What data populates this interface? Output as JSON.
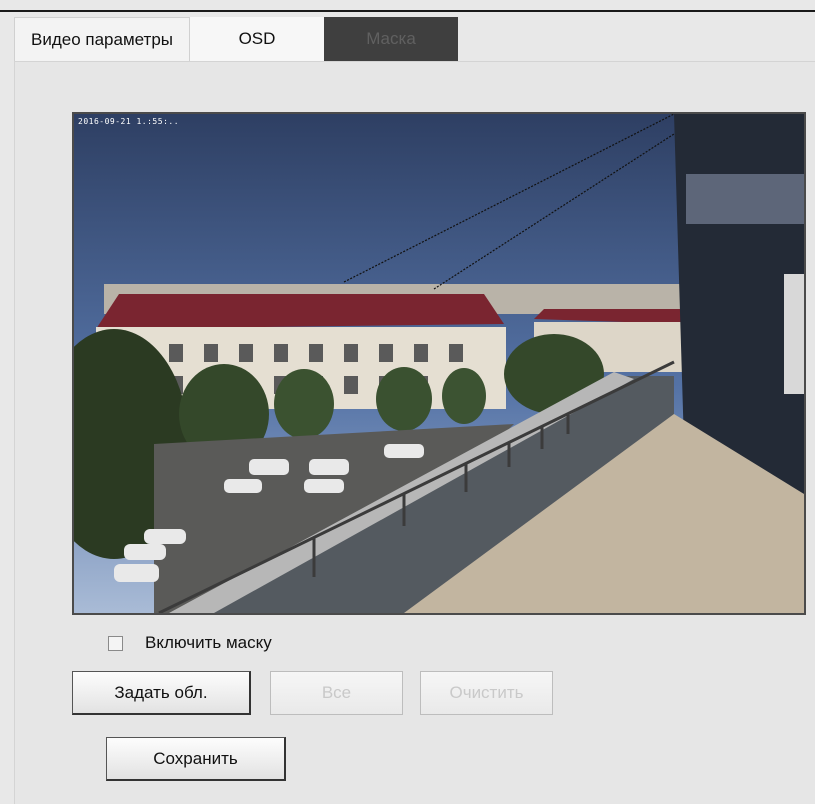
{
  "tabs": [
    {
      "label": "Видео параметры",
      "active": false
    },
    {
      "label": "OSD",
      "active": false
    },
    {
      "label": "Маска",
      "active": true
    }
  ],
  "video": {
    "osd_timestamp": "2016-09-21 1.:55:..",
    "scene": "camera-feed"
  },
  "mask": {
    "enable_label": "Включить маску",
    "enabled": false
  },
  "buttons": {
    "set_area": "Задать обл.",
    "all": "Все",
    "clear": "Очистить",
    "save": "Сохранить"
  },
  "colors": {
    "active_tab_bg": "#3f3f3f",
    "panel_bg": "#e6e6e6"
  }
}
